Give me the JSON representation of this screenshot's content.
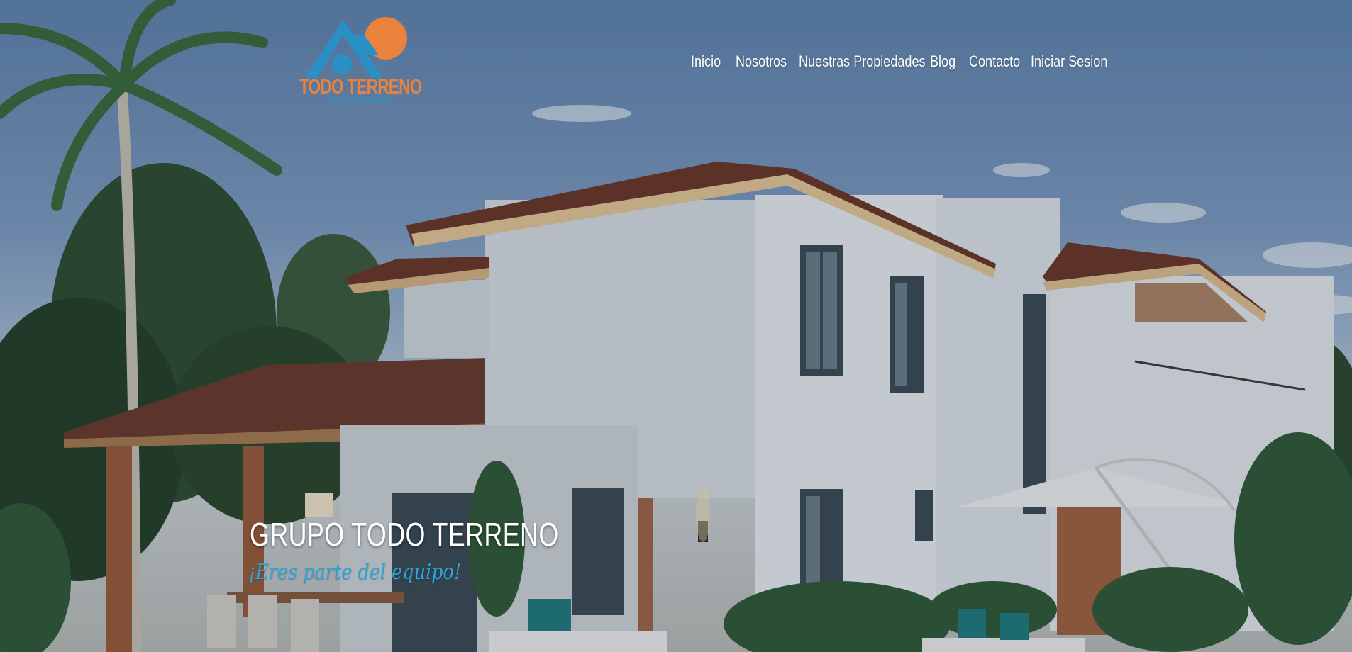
{
  "brand": {
    "name": "TODO TERRENO",
    "sub": "GRUPO INMOBILIARIO",
    "colors": {
      "orange": "#e8823d",
      "blue": "#2a8fc4",
      "accent_text": "#2aa6d8"
    }
  },
  "nav": {
    "items": [
      {
        "label": "Inicio"
      },
      {
        "label": "Nosotros"
      },
      {
        "label": "Nuestras Propiedades"
      },
      {
        "label": "Blog"
      },
      {
        "label": "Contacto"
      },
      {
        "label": "Iniciar Sesion"
      }
    ]
  },
  "hero": {
    "title": "GRUPO TODO TERRENO",
    "tagline": "¡Eres parte del equipo!"
  }
}
